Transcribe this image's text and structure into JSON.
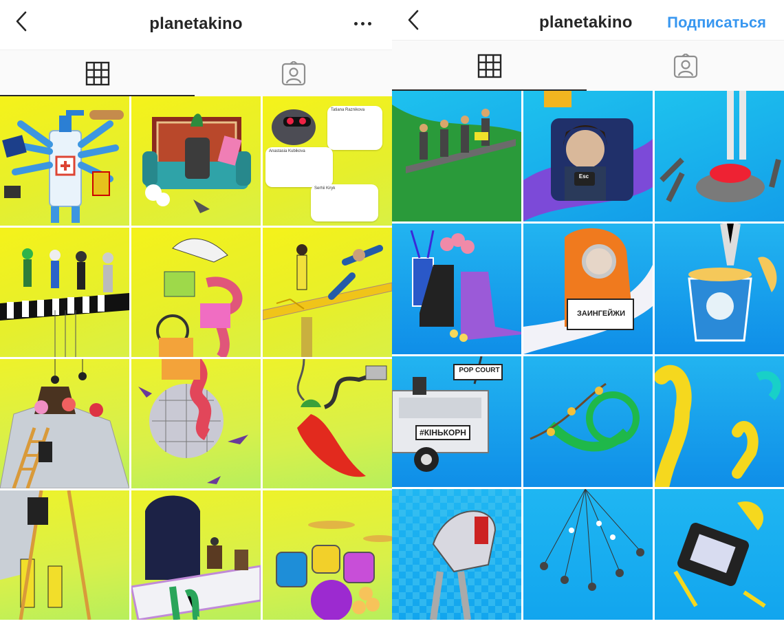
{
  "left_screen": {
    "header": {
      "title": "planetakino"
    },
    "comments": [
      "Tatiana Raznikova",
      "Anastasia Kubikova",
      "Serhii Kiryk"
    ]
  },
  "right_screen": {
    "header": {
      "title": "planetakino",
      "follow_label": "Подписаться"
    },
    "signs": {
      "pop_court": "POP COURT",
      "kinkorn": "#КІНЬКОРН",
      "zaingeyzhi": "ЗАИНГЕЙЖИ",
      "esc": "Esc"
    }
  },
  "colors": {
    "follow": "#3897f0",
    "text": "#262626",
    "yellow_bg": "#f5f21a",
    "blue_bg": "#1ea7ee"
  },
  "icons": [
    "back-chevron-icon",
    "more-dots-icon",
    "grid-icon",
    "tagged-person-icon"
  ]
}
